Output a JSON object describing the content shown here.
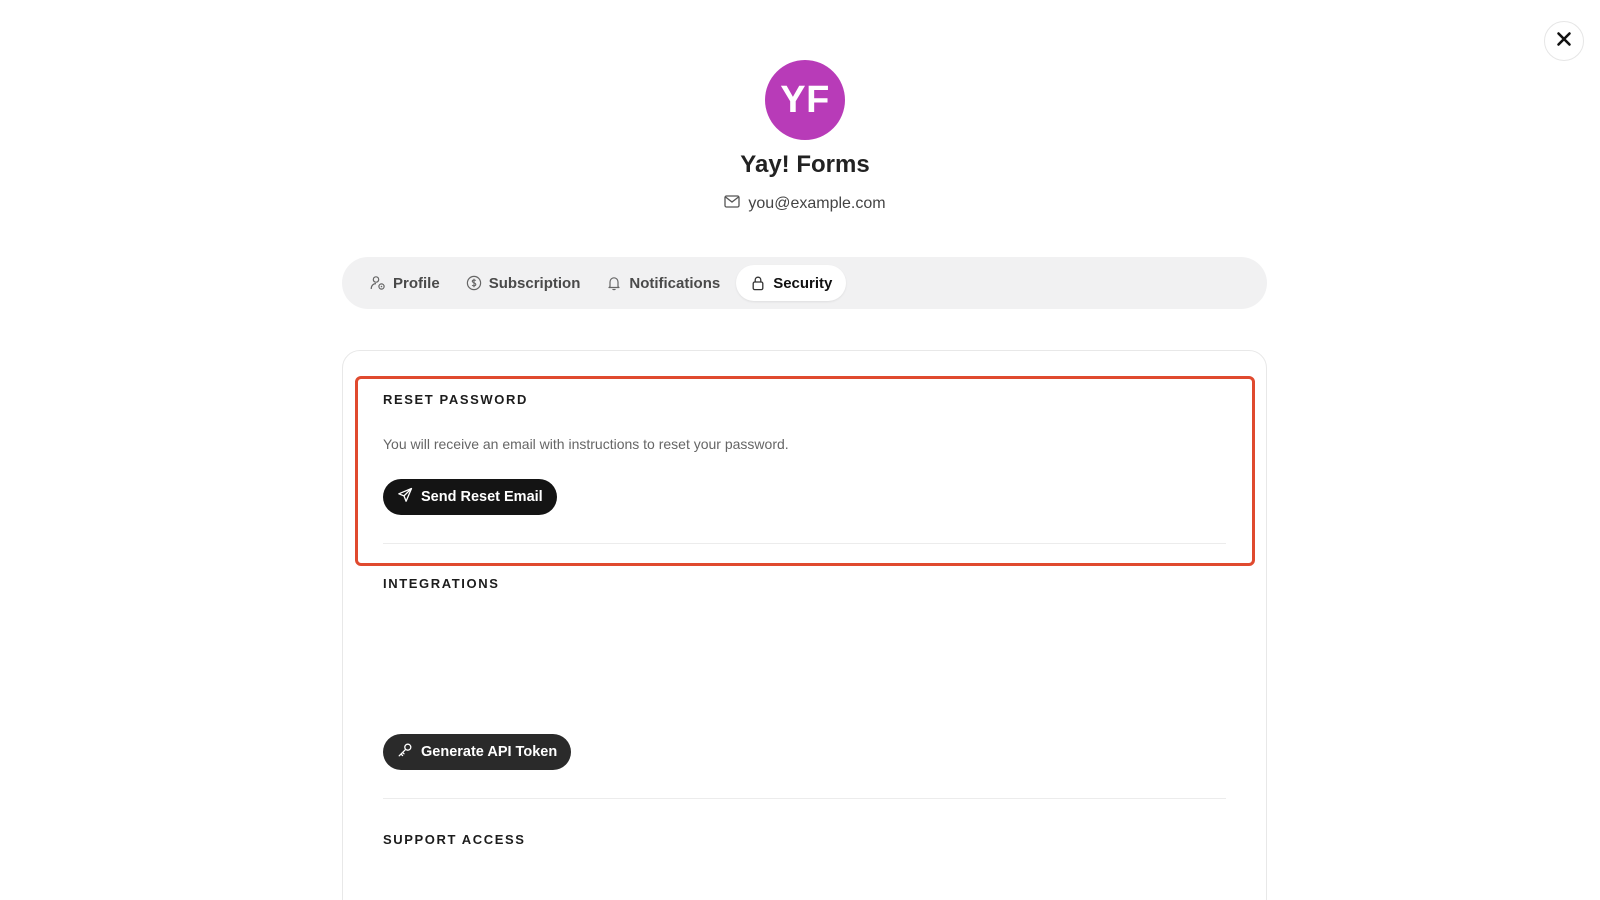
{
  "header": {
    "avatar_initials": "YF",
    "avatar_color": "#B83BB8",
    "org_name": "Yay! Forms",
    "email": "you@example.com"
  },
  "tabs": [
    {
      "label": "Profile",
      "icon": "user-settings-icon",
      "active": false
    },
    {
      "label": "Subscription",
      "icon": "dollar-circle-icon",
      "active": false
    },
    {
      "label": "Notifications",
      "icon": "bell-icon",
      "active": false
    },
    {
      "label": "Security",
      "icon": "lock-icon",
      "active": true
    }
  ],
  "sections": {
    "reset_password": {
      "title": "RESET PASSWORD",
      "description": "You will receive an email with instructions to reset your password.",
      "button_label": "Send Reset Email"
    },
    "integrations": {
      "title": "INTEGRATIONS",
      "button_label": "Generate API Token"
    },
    "support_access": {
      "title": "SUPPORT ACCESS"
    }
  },
  "colors": {
    "highlight": "#E04A2F",
    "button_bg": "#141414",
    "tab_bar_bg": "#F1F1F2"
  }
}
